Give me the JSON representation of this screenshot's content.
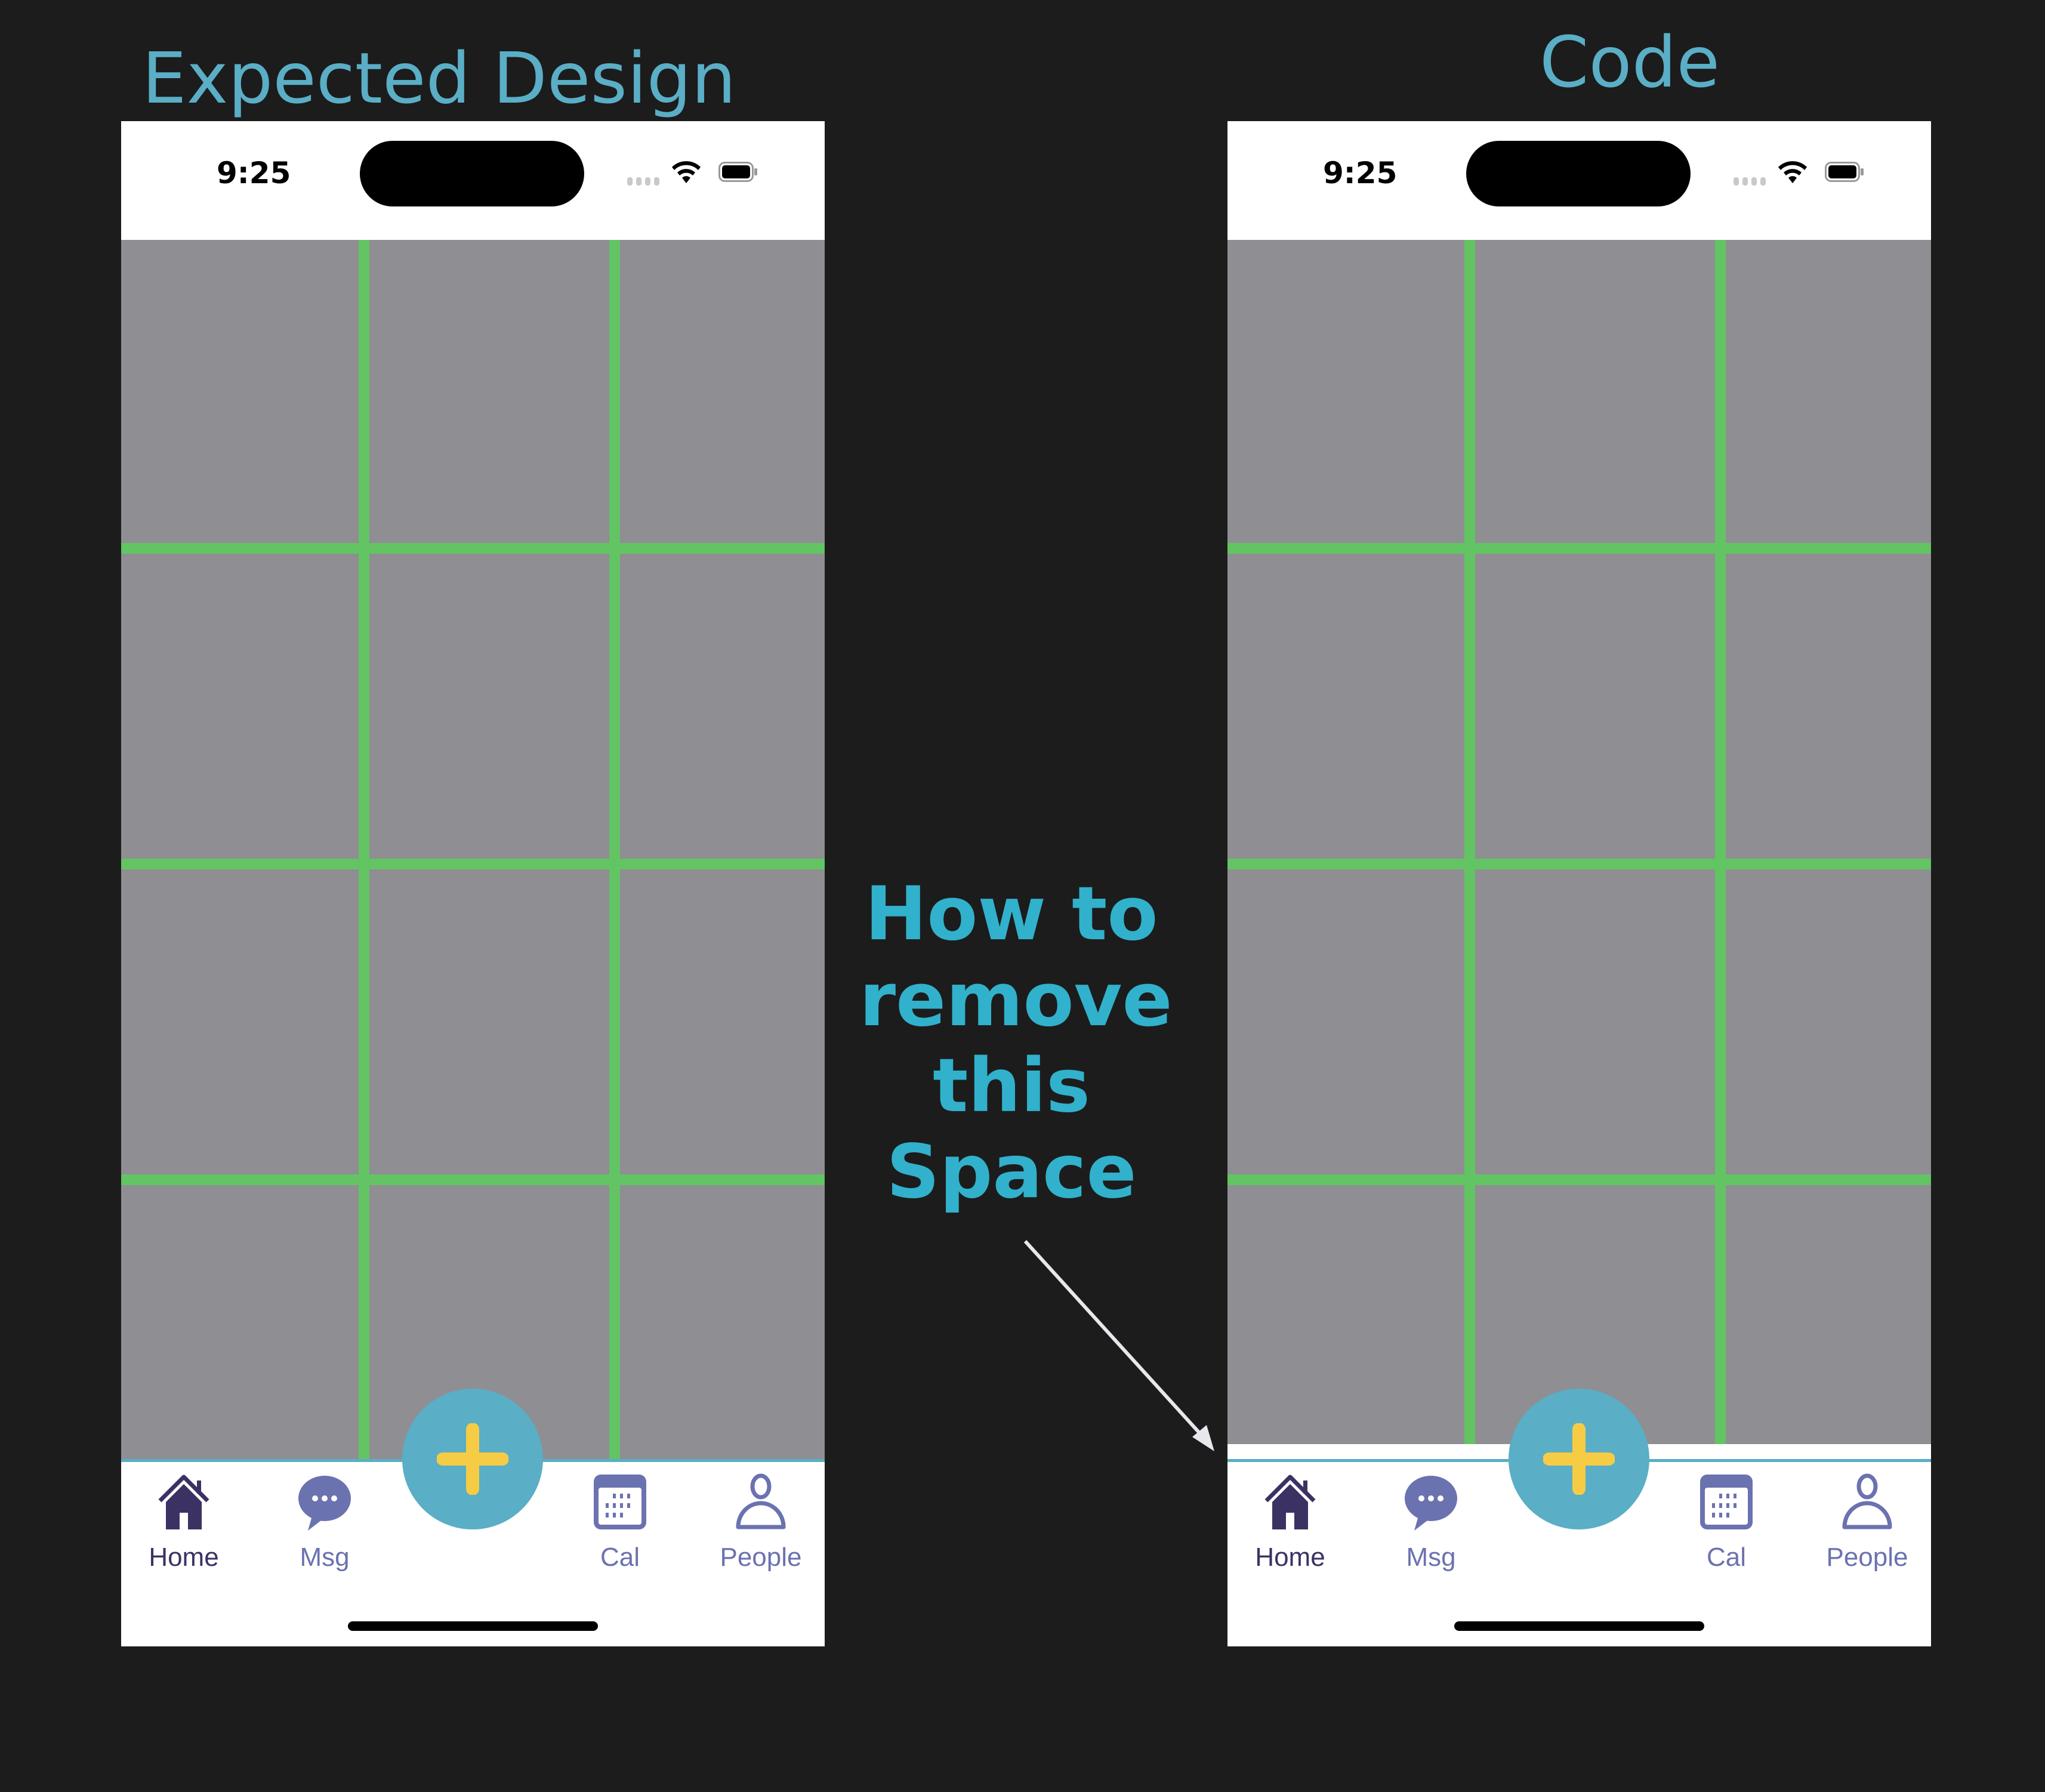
{
  "labels": {
    "expected_title": "Expected Design",
    "code_title": "Code",
    "annotation_lines": [
      "How to",
      "remove",
      "this",
      "Space"
    ]
  },
  "colors": {
    "accent_teal": "#5aaec5",
    "grid_green": "#62c463",
    "grid_gray": "#8f8e92",
    "fab_plus_yellow": "#f6cc45",
    "tab_active": "#3c3163",
    "tab_inactive": "#6b72b0"
  },
  "phones": [
    {
      "name": "expected",
      "status": {
        "time": "9:25"
      },
      "tabs": [
        {
          "label": "Home",
          "icon": "house-icon",
          "active": true
        },
        {
          "label": "Msg",
          "icon": "chat-bubble-icon",
          "active": false
        },
        {
          "label": "Cal",
          "icon": "calendar-icon",
          "active": false
        },
        {
          "label": "People",
          "icon": "person-icon",
          "active": false
        }
      ],
      "fab_icon": "plus-icon"
    },
    {
      "name": "code",
      "status": {
        "time": "9:25"
      },
      "tabs": [
        {
          "label": "Home",
          "icon": "house-icon",
          "active": true
        },
        {
          "label": "Msg",
          "icon": "chat-bubble-icon",
          "active": false
        },
        {
          "label": "Cal",
          "icon": "calendar-icon",
          "active": false
        },
        {
          "label": "People",
          "icon": "person-icon",
          "active": false
        }
      ],
      "fab_icon": "plus-icon"
    }
  ]
}
